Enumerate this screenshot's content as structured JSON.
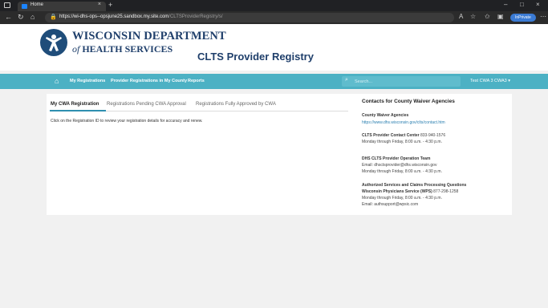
{
  "browser": {
    "tab_title": "Home",
    "tab_close": "×",
    "new_tab": "+",
    "url_host": "https://wi-dhs-ops--opsjune25.sandbox.my.site.com",
    "url_path": "/CLTSProviderRegistry/s/",
    "inprivate_label": "InPrivate",
    "window_controls": [
      "–",
      "□",
      "×"
    ]
  },
  "header": {
    "org_line1": "WISCONSIN DEPARTMENT",
    "org_line2_of": "of",
    "org_line2_rest": "HEALTH SERVICES",
    "app_title": "CLTS Provider Registry"
  },
  "nav": {
    "items": [
      "My Registrations",
      "Provider Registrations in My County",
      "Reports"
    ],
    "search_placeholder": "Search...",
    "user_menu": "Test CWA 3 CWA3 ▾"
  },
  "tabs": {
    "items": [
      "My CWA Registration",
      "Registrations Pending CWA Approval",
      "Registrations Fully Approved by CWA"
    ]
  },
  "main": {
    "instruction": "Click on the Registration ID to review your registration details for accuracy and renew."
  },
  "contacts": {
    "title": "Contacts for County Waiver Agencies",
    "county_head": "County Waiver Agencies",
    "county_link": "https://www.dhs.wisconsin.gov/clts/contact.htm",
    "center_head": "CLTS Provider Contact Center",
    "center_phone": "833-940-1576",
    "center_hours": "Monday through Friday, 8:00 a.m. - 4:30 p.m.",
    "ops_head": "DHS CLTS Provider Operation Team",
    "ops_email": "Email: dhsctsprovider@dhs.wisconsin.gov",
    "ops_hours": "Monday through Friday, 8:00 a.m. - 4:30 p.m.",
    "auth_head": "Authorized Services and Claims Processing Questions",
    "wps_head": "Wisconsin Physicians Service (WPS)",
    "wps_phone": "877-298-1258",
    "wps_hours": "Monday through Friday, 8:00 a.m. - 4:30 p.m.",
    "wps_email": "Email: authsupport@wpsic.com"
  }
}
